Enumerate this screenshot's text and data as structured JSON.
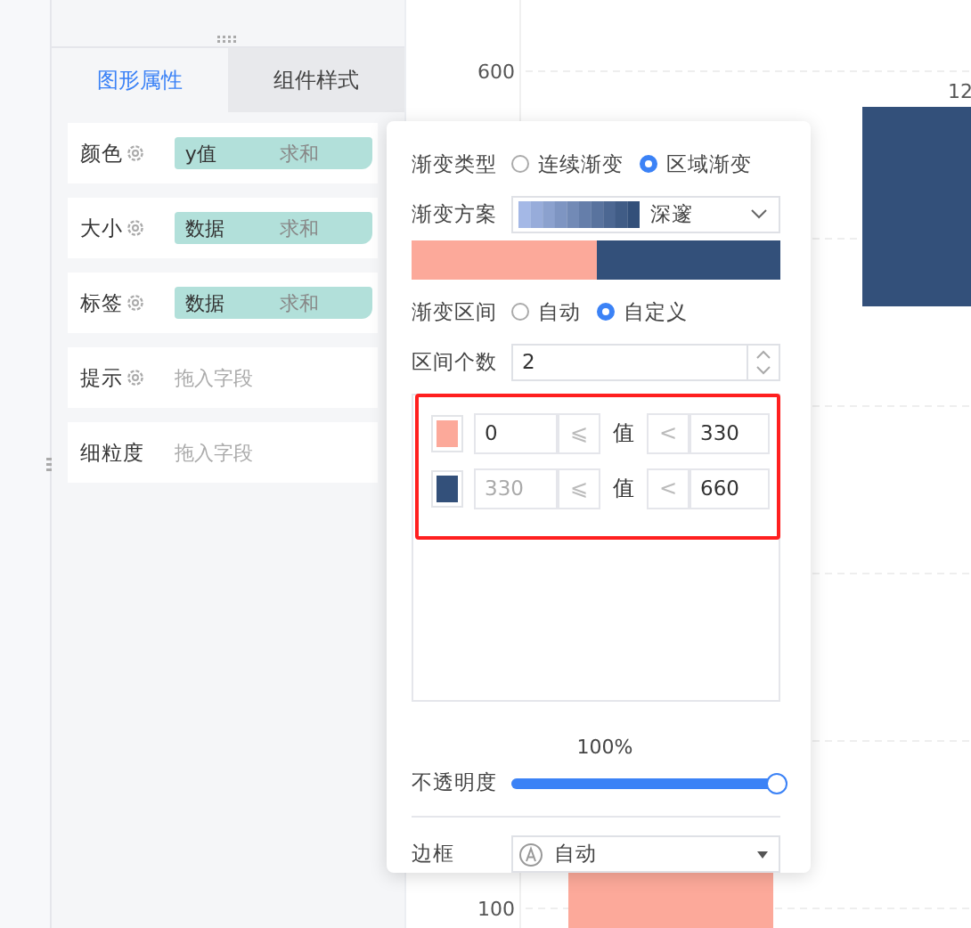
{
  "sidebar": {
    "tabs": [
      {
        "label": "图形属性",
        "selected": true
      },
      {
        "label": "组件样式",
        "selected": false
      }
    ],
    "fields": [
      {
        "label": "颜色",
        "settings": true,
        "pill": {
          "name": "y值",
          "aggregate": "求和"
        }
      },
      {
        "label": "大小",
        "settings": true,
        "pill": {
          "name": "数据",
          "aggregate": "求和"
        }
      },
      {
        "label": "标签",
        "settings": true,
        "pill": {
          "name": "数据",
          "aggregate": "求和"
        }
      },
      {
        "label": "提示",
        "settings": true,
        "placeholder": "拖入字段"
      },
      {
        "label": "细粒度",
        "settings": false,
        "placeholder": "拖入字段"
      }
    ]
  },
  "chart": {
    "y_tick_labels": [
      "600",
      "100"
    ],
    "bar_label": "12"
  },
  "popup": {
    "gradient_type": {
      "label": "渐变类型",
      "options": [
        {
          "label": "连续渐变",
          "selected": false
        },
        {
          "label": "区域渐变",
          "selected": true
        }
      ]
    },
    "scheme": {
      "label": "渐变方案",
      "value": "深邃"
    },
    "preview": [
      {
        "color": "#fca99a"
      },
      {
        "color": "#33507a"
      }
    ],
    "interval_mode": {
      "label": "渐变区间",
      "options": [
        {
          "label": "自动",
          "selected": false
        },
        {
          "label": "自定义",
          "selected": true
        }
      ]
    },
    "count": {
      "label": "区间个数",
      "value": "2"
    },
    "highlight_ranges": true,
    "ranges": [
      {
        "color": "#fca99a",
        "from": "0",
        "from_disabled": false,
        "from_op": "⩽",
        "value_label": "值",
        "to_op": "<",
        "to": "330"
      },
      {
        "color": "#33507a",
        "from": "330",
        "from_disabled": true,
        "from_op": "⩽",
        "value_label": "值",
        "to_op": "<",
        "to": "660"
      }
    ],
    "opacity": {
      "label": "不透明度",
      "reading": "100%",
      "level": 1
    },
    "border": {
      "label": "边框",
      "value": "自动"
    }
  }
}
